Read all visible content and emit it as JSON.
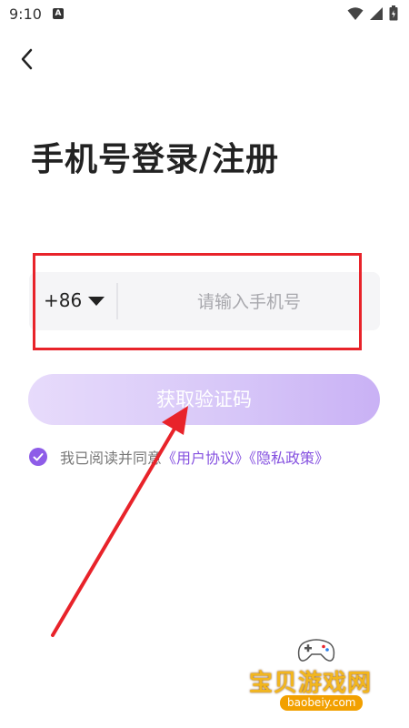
{
  "status_bar": {
    "time": "9:10",
    "notification_badge": "A",
    "icons": [
      "wifi-icon",
      "signal-icon",
      "battery-icon"
    ]
  },
  "nav": {
    "back_icon": "chevron-left-icon"
  },
  "title": "手机号登录/注册",
  "phone": {
    "country_code": "+86",
    "placeholder": "请输入手机号",
    "value": ""
  },
  "get_code_label": "获取验证码",
  "agreement": {
    "prefix": "我已阅读并同意",
    "user_agreement": "《用户协议》",
    "privacy_policy": "《隐私政策》",
    "checked": true
  },
  "watermark": {
    "logo_text": "宝贝游戏网",
    "url": "baobeiy.com"
  },
  "colors": {
    "accent": "#8e5ce8",
    "button_gradient_start": "#e7dbfb",
    "button_gradient_end": "#c9b1f5",
    "highlight": "#e8232a",
    "input_bg": "#f5f5f7"
  }
}
